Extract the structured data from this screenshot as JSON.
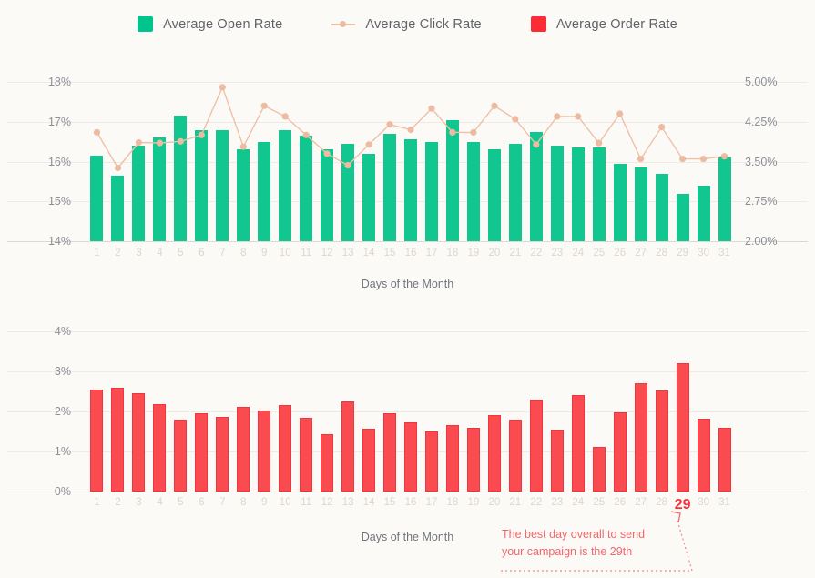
{
  "legend": {
    "items": [
      {
        "label": "Average Open Rate",
        "icon": "square-swatch-icon",
        "color": "#00C48C"
      },
      {
        "label": "Average Click Rate",
        "icon": "line-marker-swatch-icon",
        "color": "#EFC0A8"
      },
      {
        "label": "Average Order Rate",
        "icon": "square-swatch-icon",
        "color": "#FA2D36"
      }
    ]
  },
  "annotation": {
    "line1": "The best day overall to send",
    "line2": "your campaign is the 29th",
    "highlight_day": "29",
    "color": "#F4666B"
  },
  "colors": {
    "background": "#FCFAF7",
    "open_rate_green": "#12C78F",
    "click_rate_salmon": "#EFC0A8",
    "order_rate_red": "#FA4B50",
    "gridline": "#EFEAE4",
    "axis_label": "#8a8f98",
    "x_label": "#DCD6CE"
  },
  "chart_data": [
    {
      "type": "bar",
      "title": "",
      "xlabel": "Days of the Month",
      "ylabel": "",
      "categories": [
        "1",
        "2",
        "3",
        "4",
        "5",
        "6",
        "7",
        "8",
        "9",
        "10",
        "11",
        "12",
        "13",
        "14",
        "15",
        "16",
        "17",
        "18",
        "19",
        "20",
        "21",
        "22",
        "23",
        "24",
        "25",
        "26",
        "27",
        "28",
        "29",
        "30",
        "31"
      ],
      "grid": true,
      "legend_position": "top",
      "y_left": {
        "label": "Average Open Rate",
        "ticks": [
          "14%",
          "15%",
          "16%",
          "17%",
          "18%"
        ],
        "tick_values": [
          14,
          15,
          16,
          17,
          18
        ],
        "ylim": [
          14,
          18
        ]
      },
      "y_right": {
        "label": "Average Click Rate",
        "ticks": [
          "2.00%",
          "2.75%",
          "3.50%",
          "4.25%",
          "5.00%"
        ],
        "tick_values": [
          2.0,
          2.75,
          3.5,
          4.25,
          5.0
        ],
        "ylim": [
          2.0,
          5.0
        ]
      },
      "series": [
        {
          "name": "Average Open Rate",
          "kind": "bar",
          "axis": "left",
          "color": "#12C78F",
          "values": [
            16.15,
            15.65,
            16.4,
            16.6,
            17.15,
            16.8,
            16.8,
            16.3,
            16.5,
            16.8,
            16.65,
            16.3,
            16.45,
            16.2,
            16.7,
            16.55,
            16.5,
            17.05,
            16.5,
            16.3,
            16.45,
            16.75,
            16.4,
            16.35,
            16.35,
            15.95,
            15.85,
            15.7,
            15.2,
            15.4,
            16.1
          ]
        },
        {
          "name": "Average Click Rate",
          "kind": "line",
          "axis": "right",
          "color": "#EFC0A8",
          "values": [
            4.05,
            3.38,
            3.86,
            3.85,
            3.88,
            4.0,
            4.9,
            3.78,
            4.55,
            4.35,
            4.0,
            3.65,
            3.43,
            3.82,
            4.2,
            4.1,
            4.5,
            4.05,
            4.05,
            4.55,
            4.3,
            3.82,
            4.35,
            4.35,
            3.85,
            4.4,
            3.55,
            4.15,
            3.55,
            3.55,
            3.6
          ]
        }
      ]
    },
    {
      "type": "bar",
      "title": "",
      "xlabel": "Days of the Month",
      "ylabel": "",
      "categories": [
        "1",
        "2",
        "3",
        "4",
        "5",
        "6",
        "7",
        "8",
        "9",
        "10",
        "11",
        "12",
        "13",
        "14",
        "15",
        "16",
        "17",
        "18",
        "19",
        "20",
        "21",
        "22",
        "23",
        "24",
        "25",
        "26",
        "27",
        "28",
        "29",
        "30",
        "31"
      ],
      "grid": true,
      "y_left": {
        "label": "Average Order Rate",
        "ticks": [
          "0%",
          "1%",
          "2%",
          "3%",
          "4%"
        ],
        "tick_values": [
          0,
          1,
          2,
          3,
          4
        ],
        "ylim": [
          0,
          4
        ]
      },
      "series": [
        {
          "name": "Average Order Rate",
          "kind": "bar",
          "axis": "left",
          "color": "#FA4B50",
          "values": [
            2.55,
            2.6,
            2.46,
            2.18,
            1.8,
            1.96,
            1.86,
            2.12,
            2.03,
            2.15,
            1.84,
            1.43,
            2.26,
            1.57,
            1.96,
            1.73,
            1.5,
            1.65,
            1.59,
            1.9,
            1.79,
            2.3,
            1.55,
            2.4,
            1.12,
            1.97,
            2.7,
            2.53,
            3.2,
            1.81,
            1.6
          ]
        }
      ]
    }
  ]
}
